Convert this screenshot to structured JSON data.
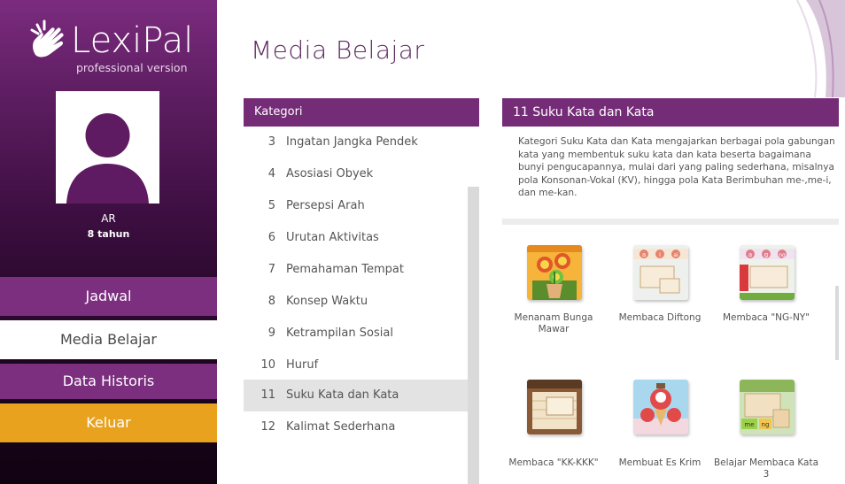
{
  "app": {
    "name": "LexiPal",
    "edition": "professional version"
  },
  "user": {
    "name": "AR",
    "age": "8 tahun"
  },
  "nav": {
    "jadwal": "Jadwal",
    "media_belajar": "Media Belajar",
    "data_historis": "Data Historis",
    "keluar": "Keluar"
  },
  "page": {
    "title": "Media Belajar"
  },
  "kategori": {
    "header": "Kategori",
    "selected": "11",
    "items": [
      {
        "num": "3",
        "label": "Ingatan Jangka Pendek"
      },
      {
        "num": "4",
        "label": "Asosiasi Obyek"
      },
      {
        "num": "5",
        "label": "Persepsi Arah"
      },
      {
        "num": "6",
        "label": "Urutan Aktivitas"
      },
      {
        "num": "7",
        "label": "Pemahaman Tempat"
      },
      {
        "num": "8",
        "label": "Konsep Waktu"
      },
      {
        "num": "9",
        "label": "Ketrampilan Sosial"
      },
      {
        "num": "10",
        "label": "Huruf"
      },
      {
        "num": "11",
        "label": "Suku Kata dan Kata"
      },
      {
        "num": "12",
        "label": "Kalimat Sederhana"
      }
    ]
  },
  "detail": {
    "header": "11 Suku Kata dan Kata",
    "description": "Kategori Suku Kata dan Kata mengajarkan berbagai pola gabungan kata yang membentuk suku kata dan kata beserta bagaimana bunyi pengucapannya, mulai dari yang paling sederhana, misalnya pola Konsonan-Vokal (KV), hingga pola Kata Berimbuhan me-,me-i, dan me-kan.",
    "tiles": [
      {
        "label": "Menanam Bunga Mawar",
        "icon": "flower-pot-icon"
      },
      {
        "label": "Membaca Diftong",
        "icon": "diphthong-cards-icon"
      },
      {
        "label": "Membaca \"NG-NY\"",
        "icon": "ng-ny-cards-icon"
      },
      {
        "label": "Membaca \"KK-KKK\"",
        "icon": "kk-kkk-cards-icon"
      },
      {
        "label": "Membuat Es Krim",
        "icon": "ice-cream-icon"
      },
      {
        "label": "Belajar Membaca Kata 3",
        "icon": "word-cards-icon"
      }
    ],
    "tile_texts": {
      "diftong_a": "a",
      "diftong_i": "i",
      "diftong_ai": "ai",
      "ng_a": "a",
      "ng_g": "g",
      "ng_ng": "ng",
      "kata_me": "me",
      "kata_ng": "ng"
    }
  },
  "colors": {
    "purple": "#742c77",
    "purple_nav": "#7c2e7f",
    "orange": "#e8a21e",
    "selected_row": "#e3e3e3"
  }
}
